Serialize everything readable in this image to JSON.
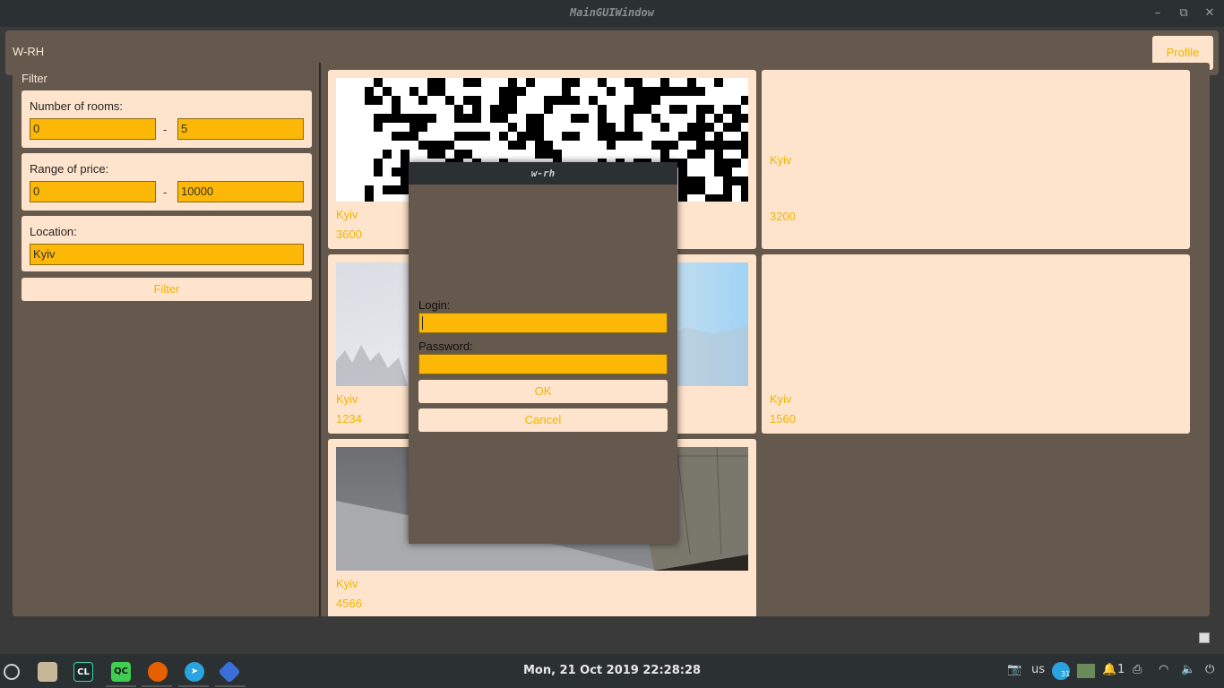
{
  "window": {
    "title": "MainGUIWindow",
    "minimize": "–",
    "maximize": "⧉",
    "close": "✕"
  },
  "header": {
    "app_title": "W-RH",
    "profile_label": "Profile"
  },
  "filter": {
    "title": "Filter",
    "rooms": {
      "label": "Number of rooms:",
      "from": "0",
      "to": "5",
      "sep": "-"
    },
    "price": {
      "label": "Range of price:",
      "from": "0",
      "to": "10000",
      "sep": "-"
    },
    "location": {
      "label": "Location:",
      "value": "Kyiv"
    },
    "button_label": "Filter"
  },
  "listings": [
    {
      "location": "Kyiv",
      "price": "3600",
      "image": "qr-pattern"
    },
    {
      "location": "Kyiv",
      "price": "3200",
      "image": ""
    },
    {
      "location": "Kyiv",
      "price": "1234",
      "image": "foggy-forest"
    },
    {
      "location": "Kyiv",
      "price": "1560",
      "image": ""
    },
    {
      "location": "Kyiv",
      "price": "4566",
      "image": "interior-wall"
    }
  ],
  "dialog": {
    "title": "w-rh",
    "login_label": "Login:",
    "login_value": "",
    "password_label": "Password:",
    "password_value": "",
    "ok_label": "OK",
    "cancel_label": "Cancel"
  },
  "taskbar": {
    "clock": "Mon, 21 Oct 2019 22:28:28",
    "keyboard_layout": "us",
    "notifications": "1",
    "apps": [
      "menu-icon",
      "files-icon",
      "clion-icon",
      "qtcreator-icon",
      "firefox-icon",
      "telegram-icon",
      "app-icon"
    ],
    "calendar_badge": "31"
  },
  "colors": {
    "accent": "#fdb706",
    "card_bg": "#ffe4cd",
    "panel_bg": "#65594e",
    "label_accent": "#f0b400"
  }
}
